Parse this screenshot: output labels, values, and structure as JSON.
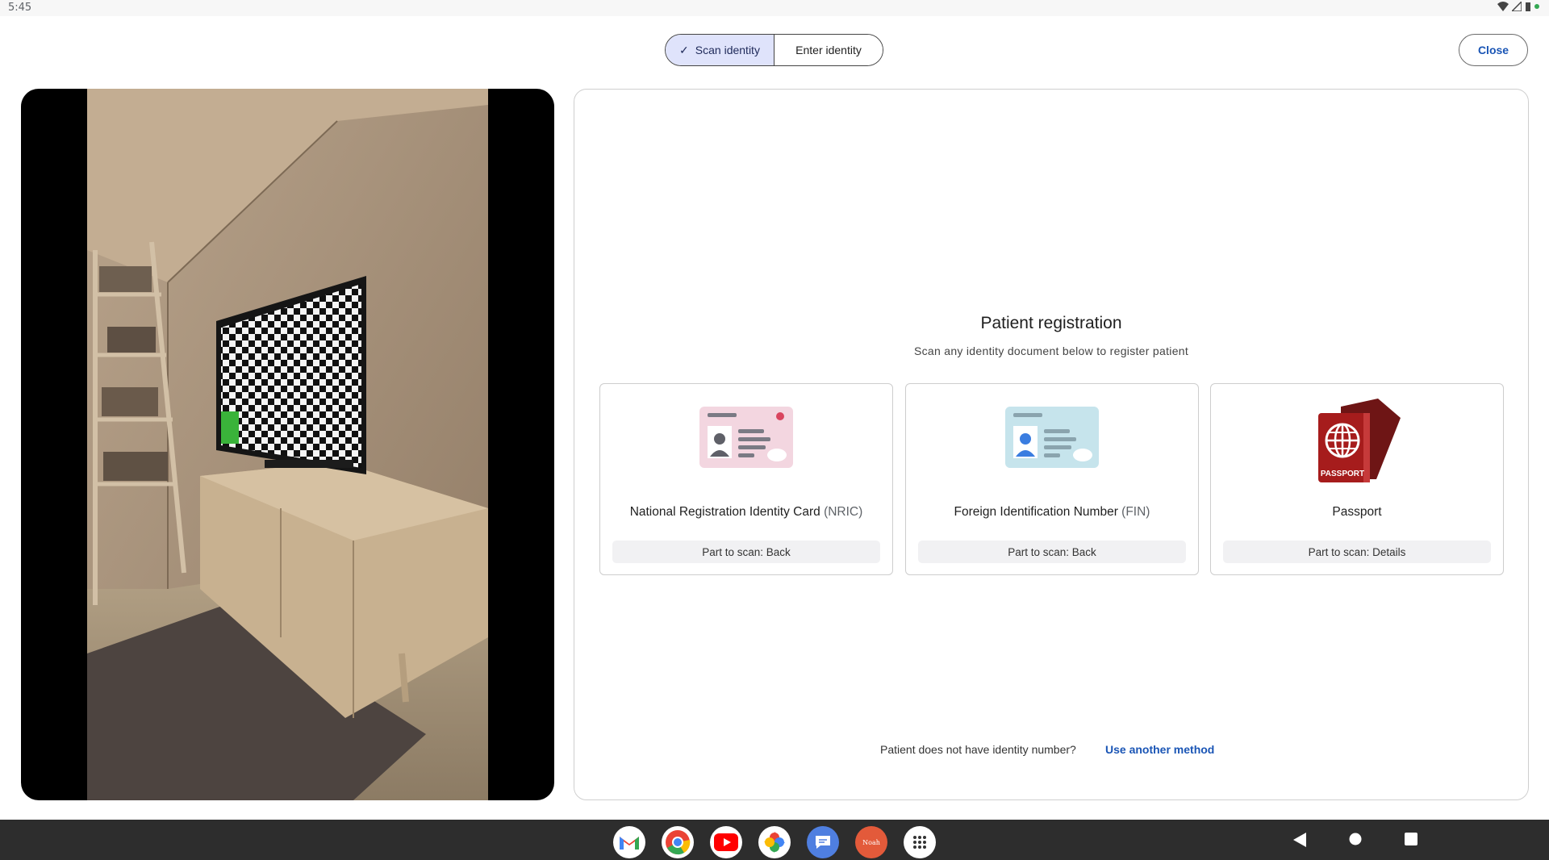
{
  "status_bar": {
    "time": "5:45"
  },
  "mode_toggle": {
    "scan_label": "Scan identity",
    "enter_label": "Enter identity",
    "selected": "scan"
  },
  "close_label": "Close",
  "registration": {
    "title": "Patient registration",
    "subtitle": "Scan any identity document below to register patient",
    "documents": [
      {
        "name": "National Registration Identity Card",
        "abbr": "(NRIC)",
        "part": "Part to scan: Back",
        "icon": "nric-card-icon",
        "color": "#f3d6e0"
      },
      {
        "name": "Foreign Identification Number",
        "abbr": "(FIN)",
        "part": "Part to scan: Back",
        "icon": "fin-card-icon",
        "color": "#c6e4ec"
      },
      {
        "name": "Passport",
        "abbr": "",
        "part": "Part to scan: Details",
        "icon": "passport-icon",
        "color": "#a61c1c"
      }
    ],
    "passport_stamp": "PASSPORT",
    "no_id_question": "Patient does not have identity number?",
    "alt_method_label": "Use another method"
  },
  "dock_apps": [
    "gmail-icon",
    "chrome-icon",
    "youtube-icon",
    "photos-icon",
    "messages-icon",
    "noah-app-icon",
    "app-drawer-icon"
  ],
  "dock_noah_label": "Noah",
  "nav_buttons": [
    "back-icon",
    "home-icon",
    "recents-icon"
  ]
}
